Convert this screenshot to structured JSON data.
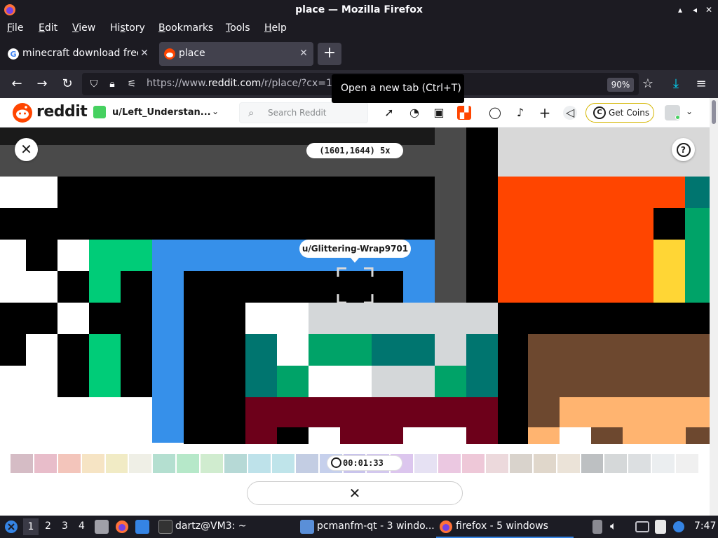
{
  "window": {
    "title": "place — Mozilla Firefox"
  },
  "menu": [
    {
      "key": "F",
      "rest": "ile"
    },
    {
      "key": "E",
      "rest": "dit"
    },
    {
      "key": "V",
      "rest": "iew"
    },
    {
      "key": "H",
      "rest": "istory",
      "pre": "Hi",
      "post": "tory",
      "mid": "s"
    },
    {
      "key": "B",
      "rest": "ookmarks"
    },
    {
      "key": "T",
      "rest": "ools"
    },
    {
      "key": "H",
      "rest": "elp"
    }
  ],
  "tabs": [
    {
      "label": "minecraft download free",
      "active": false
    },
    {
      "label": "place",
      "active": true
    }
  ],
  "tooltip": "Open a new tab (Ctrl+T)",
  "url": {
    "prefix": "https://www.",
    "domain": "reddit.com",
    "path": "/r/place/?cx=1"
  },
  "zoom": "90%",
  "reddit": {
    "logo_text": "reddit",
    "user": "u/Left_Understan...",
    "search_placeholder": "Search Reddit",
    "get_coins": "Get Coins"
  },
  "place": {
    "coords": "(1601,1644) 5x",
    "hover_user": "u/Glittering-Wrap9701",
    "timer": "00:01:33"
  },
  "palette": [
    "#d5bcc5",
    "#e8bdca",
    "#f3c5bb",
    "#f6e4c4",
    "#f1ebc5",
    "#efefe6",
    "#b4dfd0",
    "#b6e8c9",
    "#d0eccf",
    "#b6d9d6",
    "#bee2ea",
    "#bfe4ea",
    "#c3cde3",
    "#c6d0ec",
    "#c9c4ec",
    "#d3c8ee",
    "#dcc6ee",
    "#e6e1f3",
    "#ebc8e1",
    "#eec8d8",
    "#ecd9dc",
    "#d9d3cc",
    "#e0d7cb",
    "#ebe3d8",
    "#bdc0c2",
    "#d5d8d9",
    "#dcdfe1",
    "#ebeef0",
    "#f0f0f0"
  ],
  "taskbar": {
    "workspaces": [
      "1",
      "2",
      "3",
      "4"
    ],
    "tasks": [
      {
        "label": "dartz@VM3: ~"
      },
      {
        "label": "pcmanfm-qt - 3 windo..."
      },
      {
        "label": "firefox - 5 windows"
      }
    ],
    "clock": "7:47"
  },
  "colors": {
    "reddit_orange": "#ff4500",
    "place_blue": "#3690ea",
    "place_green": "#00cc78",
    "place_teal": "#00756f",
    "place_darkgreen": "#00a368",
    "place_maroon": "#6d001a",
    "place_orange": "#ff4500",
    "place_yellow": "#ffd635",
    "place_brown": "#6d482f",
    "place_tan": "#ffb470",
    "place_gray": "#d4d7d9"
  }
}
